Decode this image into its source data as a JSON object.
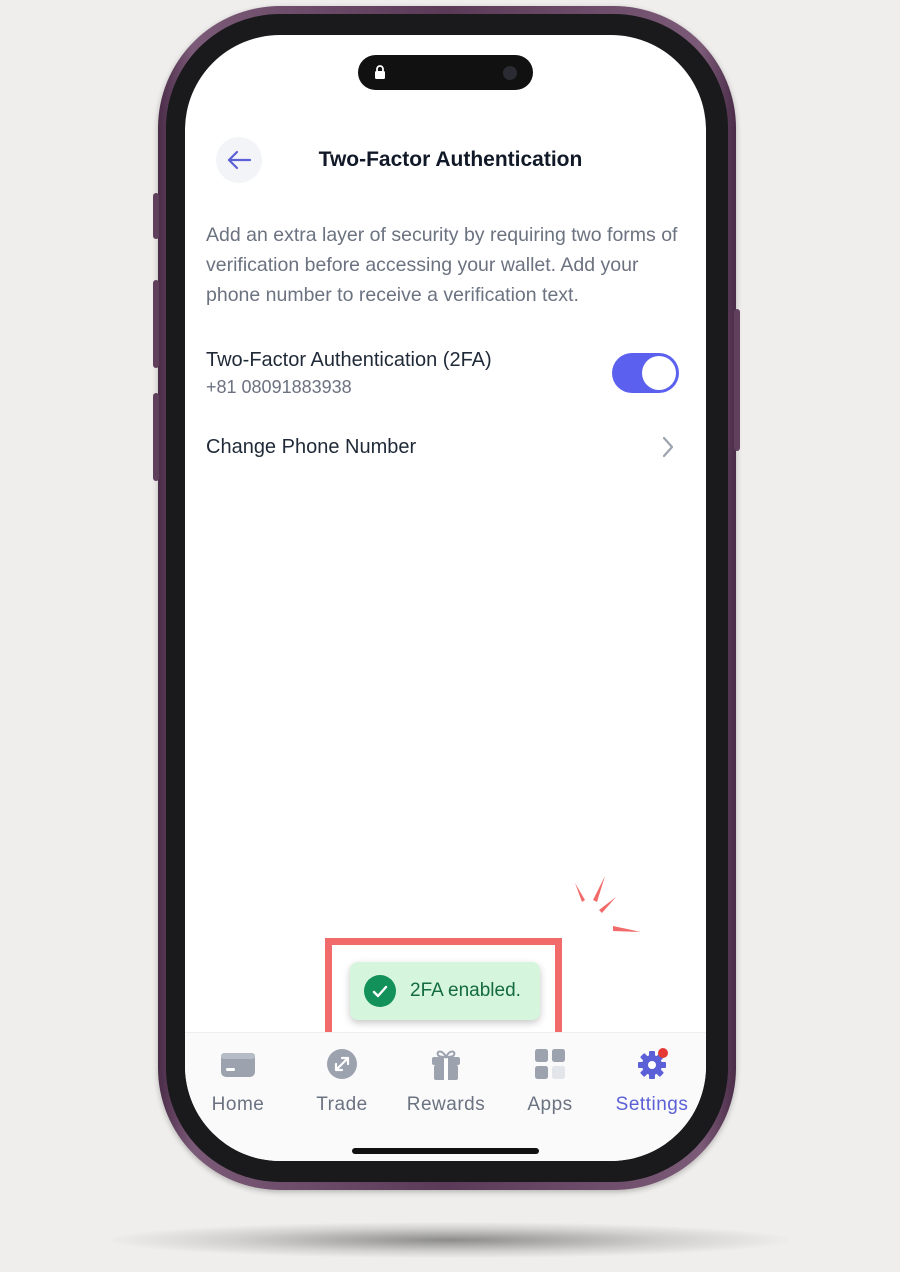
{
  "header": {
    "title": "Two-Factor Authentication",
    "back_icon": "arrow-left-icon"
  },
  "description": "Add an extra layer of security by requiring two forms of verification before accessing your wallet. Add your phone number to receive a verification text.",
  "twofa": {
    "label": "Two-Factor Authentication (2FA)",
    "phone": "+81 08091883938",
    "enabled": true
  },
  "change_phone": {
    "label": "Change Phone Number"
  },
  "toast": {
    "text": "2FA enabled."
  },
  "tabs": [
    {
      "label": "Home",
      "icon": "wallet-card-icon",
      "active": false
    },
    {
      "label": "Trade",
      "icon": "trade-arrows-icon",
      "active": false
    },
    {
      "label": "Rewards",
      "icon": "gift-icon",
      "active": false
    },
    {
      "label": "Apps",
      "icon": "apps-grid-icon",
      "active": false
    },
    {
      "label": "Settings",
      "icon": "gear-icon",
      "active": true
    }
  ],
  "colors": {
    "accent": "#5b60ee",
    "toast_bg": "#d6f5dd",
    "toast_check": "#13915a",
    "highlight": "#f26b6b",
    "phone_frame": "#5a3a57"
  }
}
